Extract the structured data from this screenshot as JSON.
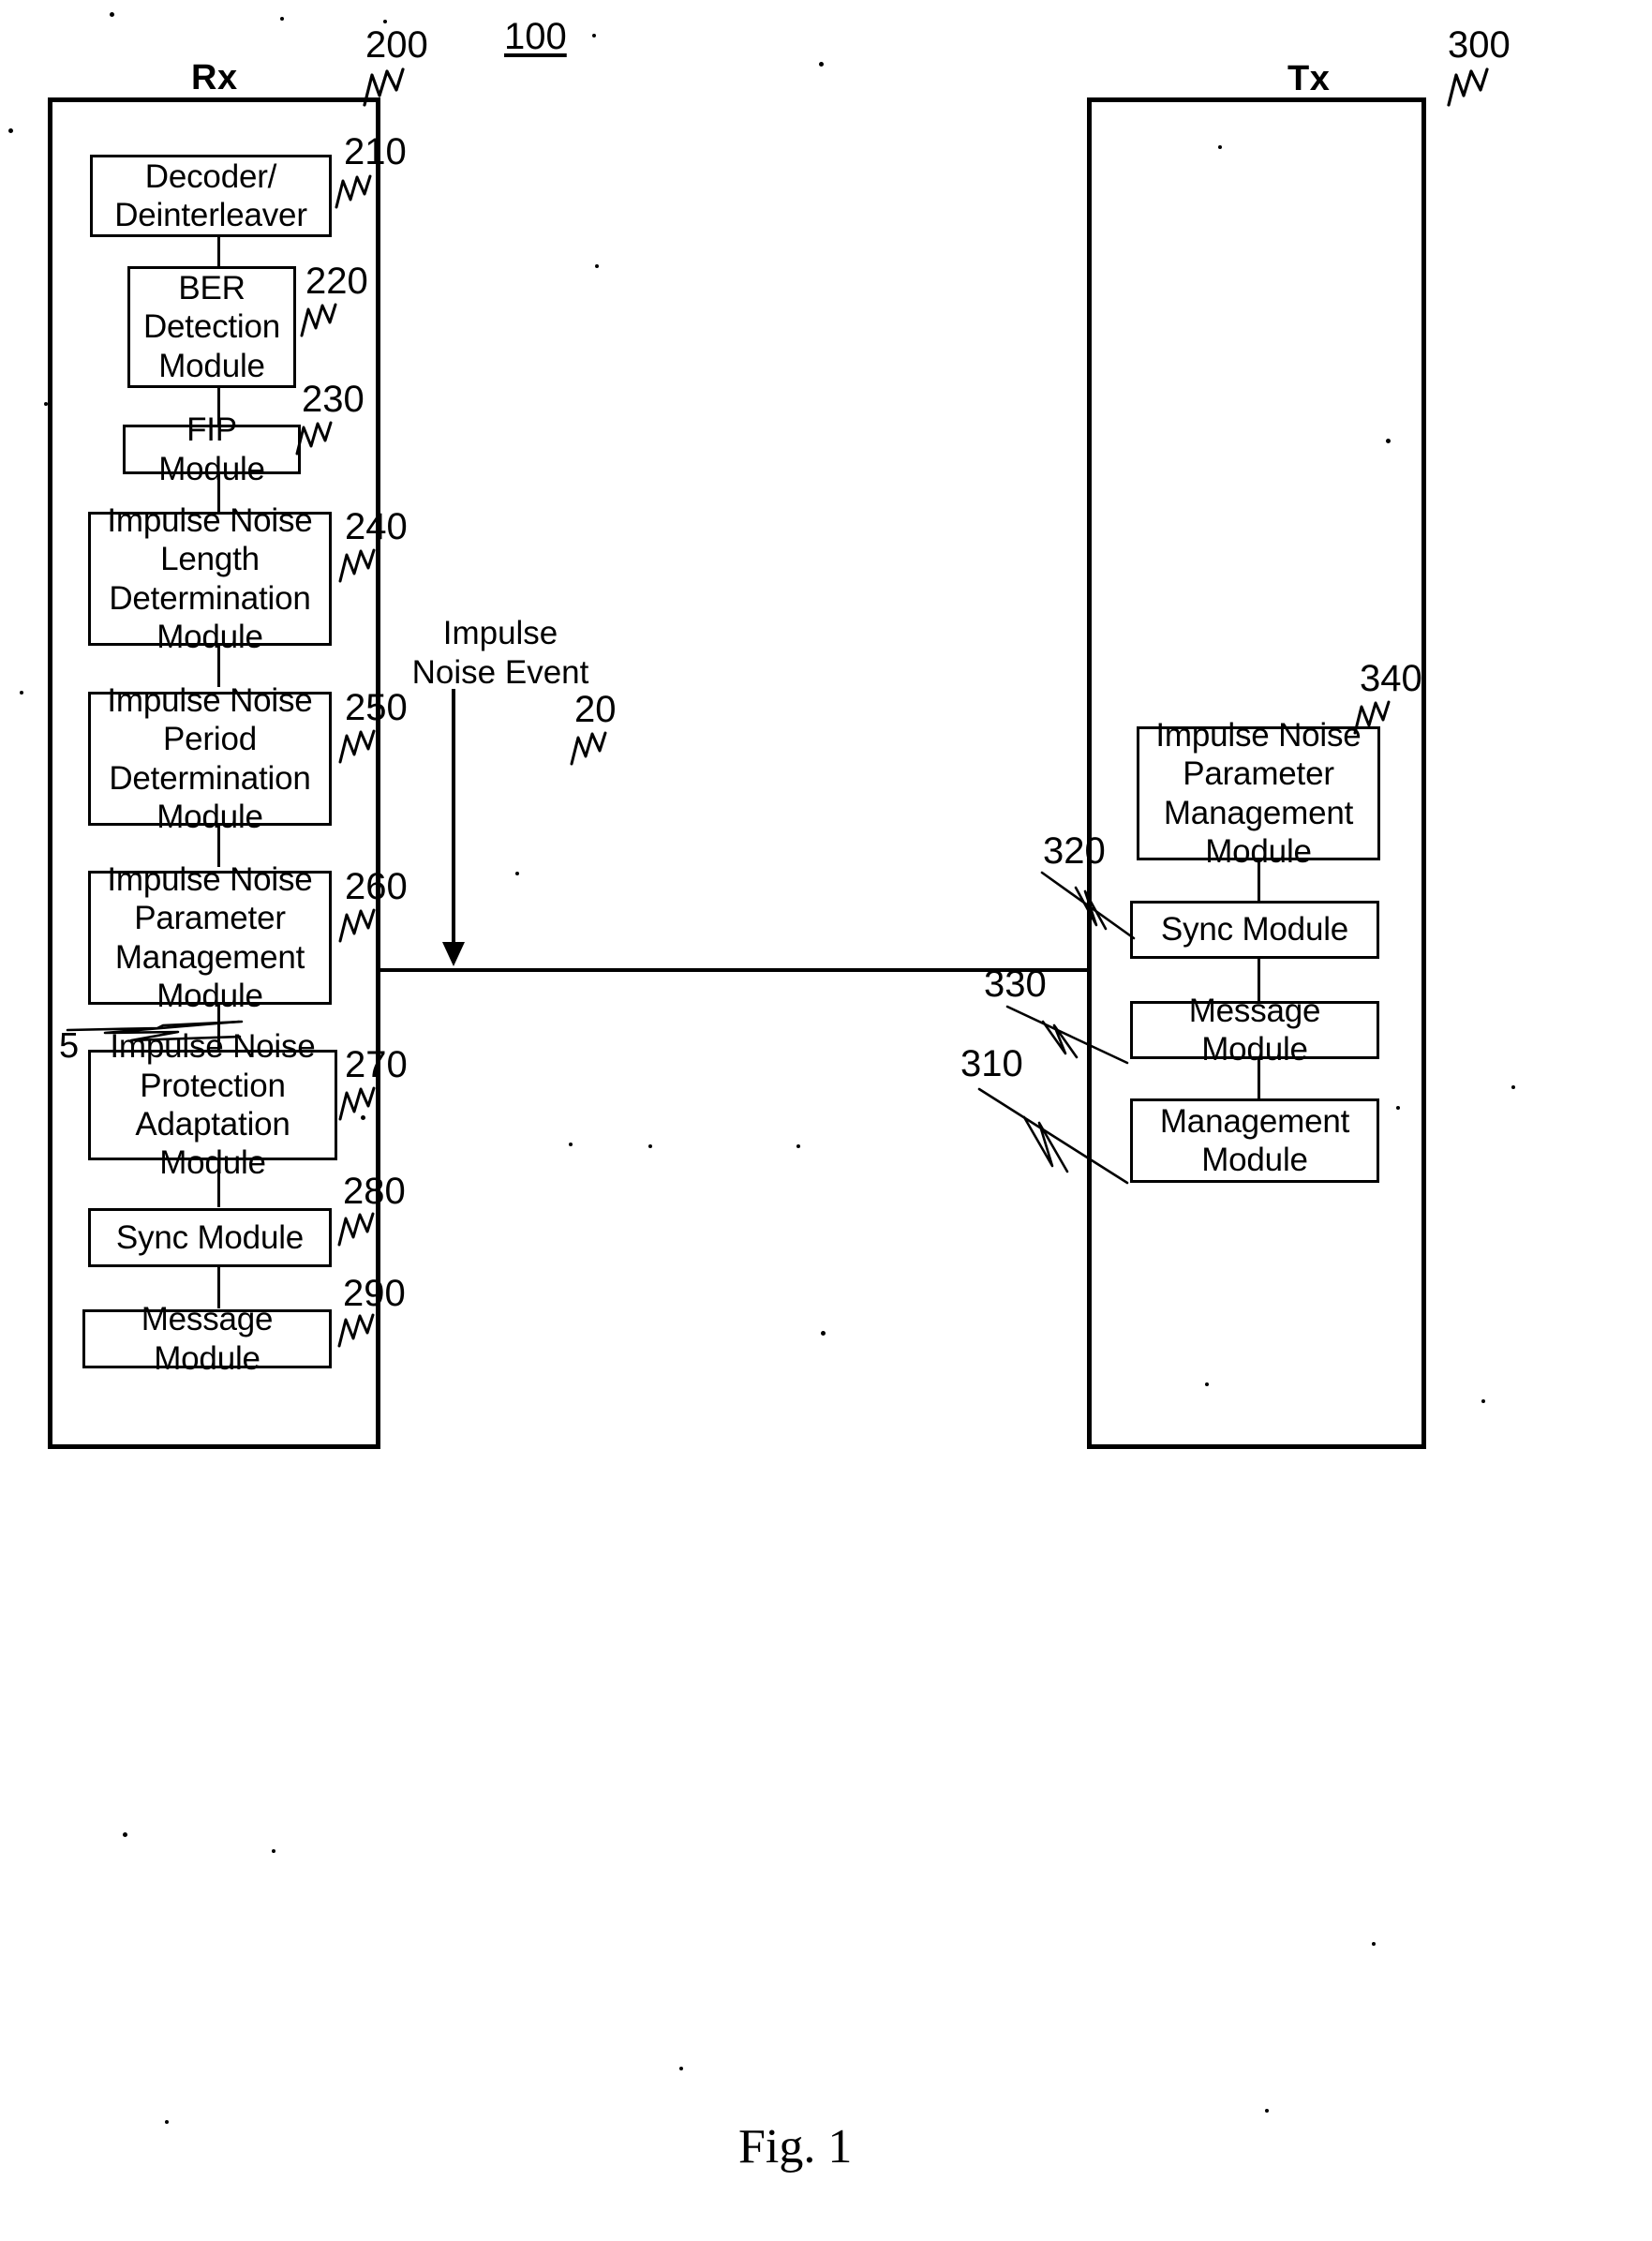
{
  "figure": {
    "caption": "Fig. 1",
    "system_ref": "100"
  },
  "receiver": {
    "label": "Rx",
    "ref": "200",
    "modules": [
      {
        "ref": "210",
        "label": "Decoder/\nDeinterleaver"
      },
      {
        "ref": "220",
        "label": "BER\nDetection\nModule"
      },
      {
        "ref": "230",
        "label": "FIP Module"
      },
      {
        "ref": "240",
        "label": "Impulse Noise\nLength\nDetermination\nModule"
      },
      {
        "ref": "250",
        "label": "Impulse Noise\nPeriod\nDetermination\nModule"
      },
      {
        "ref": "260",
        "label": "Impulse Noise\nParameter\nManagement\nModule"
      },
      {
        "ref": "270",
        "label": "Impulse Noise\nProtection\nAdaptation Module"
      },
      {
        "ref": "280",
        "label": "Sync Module"
      },
      {
        "ref": "290",
        "label": "Message Module"
      }
    ],
    "extra_ref": "5"
  },
  "transmitter": {
    "label": "Tx",
    "ref": "300",
    "modules": [
      {
        "ref": "340",
        "label": "Impulse Noise\nParameter\nManagement\nModule"
      },
      {
        "ref": "320",
        "label": "Sync Module"
      },
      {
        "ref": "330",
        "label": "Message Module"
      },
      {
        "ref": "310",
        "label": "Management\nModule"
      }
    ]
  },
  "link": {
    "ref": "20",
    "event_label": "Impulse\nNoise Event"
  },
  "colors": {
    "ink": "#000000",
    "paper": "#ffffff"
  }
}
